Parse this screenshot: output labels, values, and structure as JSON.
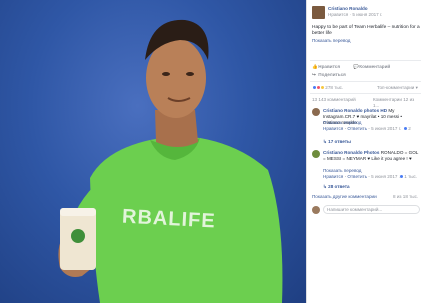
{
  "post": {
    "author": "Cristiano Ronaldo",
    "follow": "Нравится",
    "time": "5 июня 2017 г.",
    "text": "Happy to be part of Team Herbalife – nutrition for a better life",
    "translate": "Показать перевод"
  },
  "photo": {
    "shirt_text": "RBALIFE"
  },
  "actions": {
    "like": "Нравится",
    "comment": "Комментарий",
    "share": "Поделиться"
  },
  "reactions": {
    "count": "278 тыс.",
    "mode": "Топ-комментарии ▾",
    "comments_count": "13 143 комментарий",
    "hint": "Комментарии 12 из 1..."
  },
  "comments": [
    {
      "author": "Cristiano Ronaldo photos HD",
      "text": "My Instagram.CR.7 ♥ mayrilat • 10 messi • cristiano.ronaldo",
      "translate": "Показать перевод",
      "like": "Нравится",
      "reply": "Ответить",
      "more": "3 нед.",
      "time": "5 июня 2017 г.",
      "likes": "2",
      "replies": "17 ответы"
    },
    {
      "author": "Cristiano Ronaldo Photos",
      "text": "RONALDO = GOL = MESSI = NEYMAR ♥ Like it you agree ! ♥",
      "translate": "Показать перевод",
      "like": "Нравится",
      "reply": "Ответить",
      "more": "3 нед.",
      "time": "5 июня 2017 г.",
      "likes": "1 тыс.",
      "replies": "28 ответа"
    }
  ],
  "footer": {
    "more_comments": "Показать другие комментарии",
    "page": "8 из 18 тыс.",
    "input_placeholder": "Напишите комментарий..."
  },
  "colors": {
    "shirt": "#7bd85a",
    "link": "#385898",
    "background": "#2f57a6"
  }
}
